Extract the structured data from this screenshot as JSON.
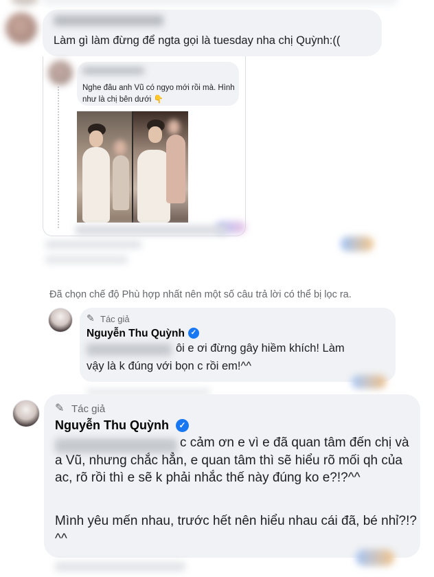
{
  "comments": {
    "first": {
      "text": "Làm gì làm đừng để ngta gọi là tuesday nha chị Quỳnh:(("
    },
    "shared": {
      "text": "Nghe đâu anh Vũ có ngyo mới rồi mà. Hình như là chị bên dưới 👇"
    },
    "filter_note": "Đã chọn chế độ Phù hợp nhất nên một số câu trả lời có thể bị lọc ra.",
    "reply": {
      "author_tag": "Tác giả",
      "author_name": "Nguyễn Thu Quỳnh",
      "text_line1": "ôi e ơi đừng gây hiềm khích! Làm",
      "text_line2": "vậy là k đúng với bọn c rồi em!^^"
    },
    "main": {
      "author_tag": "Tác giả",
      "author_name": "Nguyễn Thu Quỳnh",
      "text_part1": "c cảm ơn e vì e đã quan tâm đến chị và a Vũ, nhưng chắc hẳn, e quan tâm thì sẽ hiểu rõ mối qh của ac, rõ rồi thì e sẽ k phải nhắc thế này đúng ko e?!?^^",
      "text_part2": "Mình yêu mến nhau, trước hết nên hiểu nhau cái đã, bé nhỉ?!?^^"
    }
  },
  "icons": {
    "author_tag": "pencil-icon",
    "verified": "verified-badge-icon",
    "pointing": "pointing-down-emoji"
  },
  "colors": {
    "bubble": "#f0f2f5",
    "verified": "#1877f2",
    "secondary_text": "#65676b"
  }
}
